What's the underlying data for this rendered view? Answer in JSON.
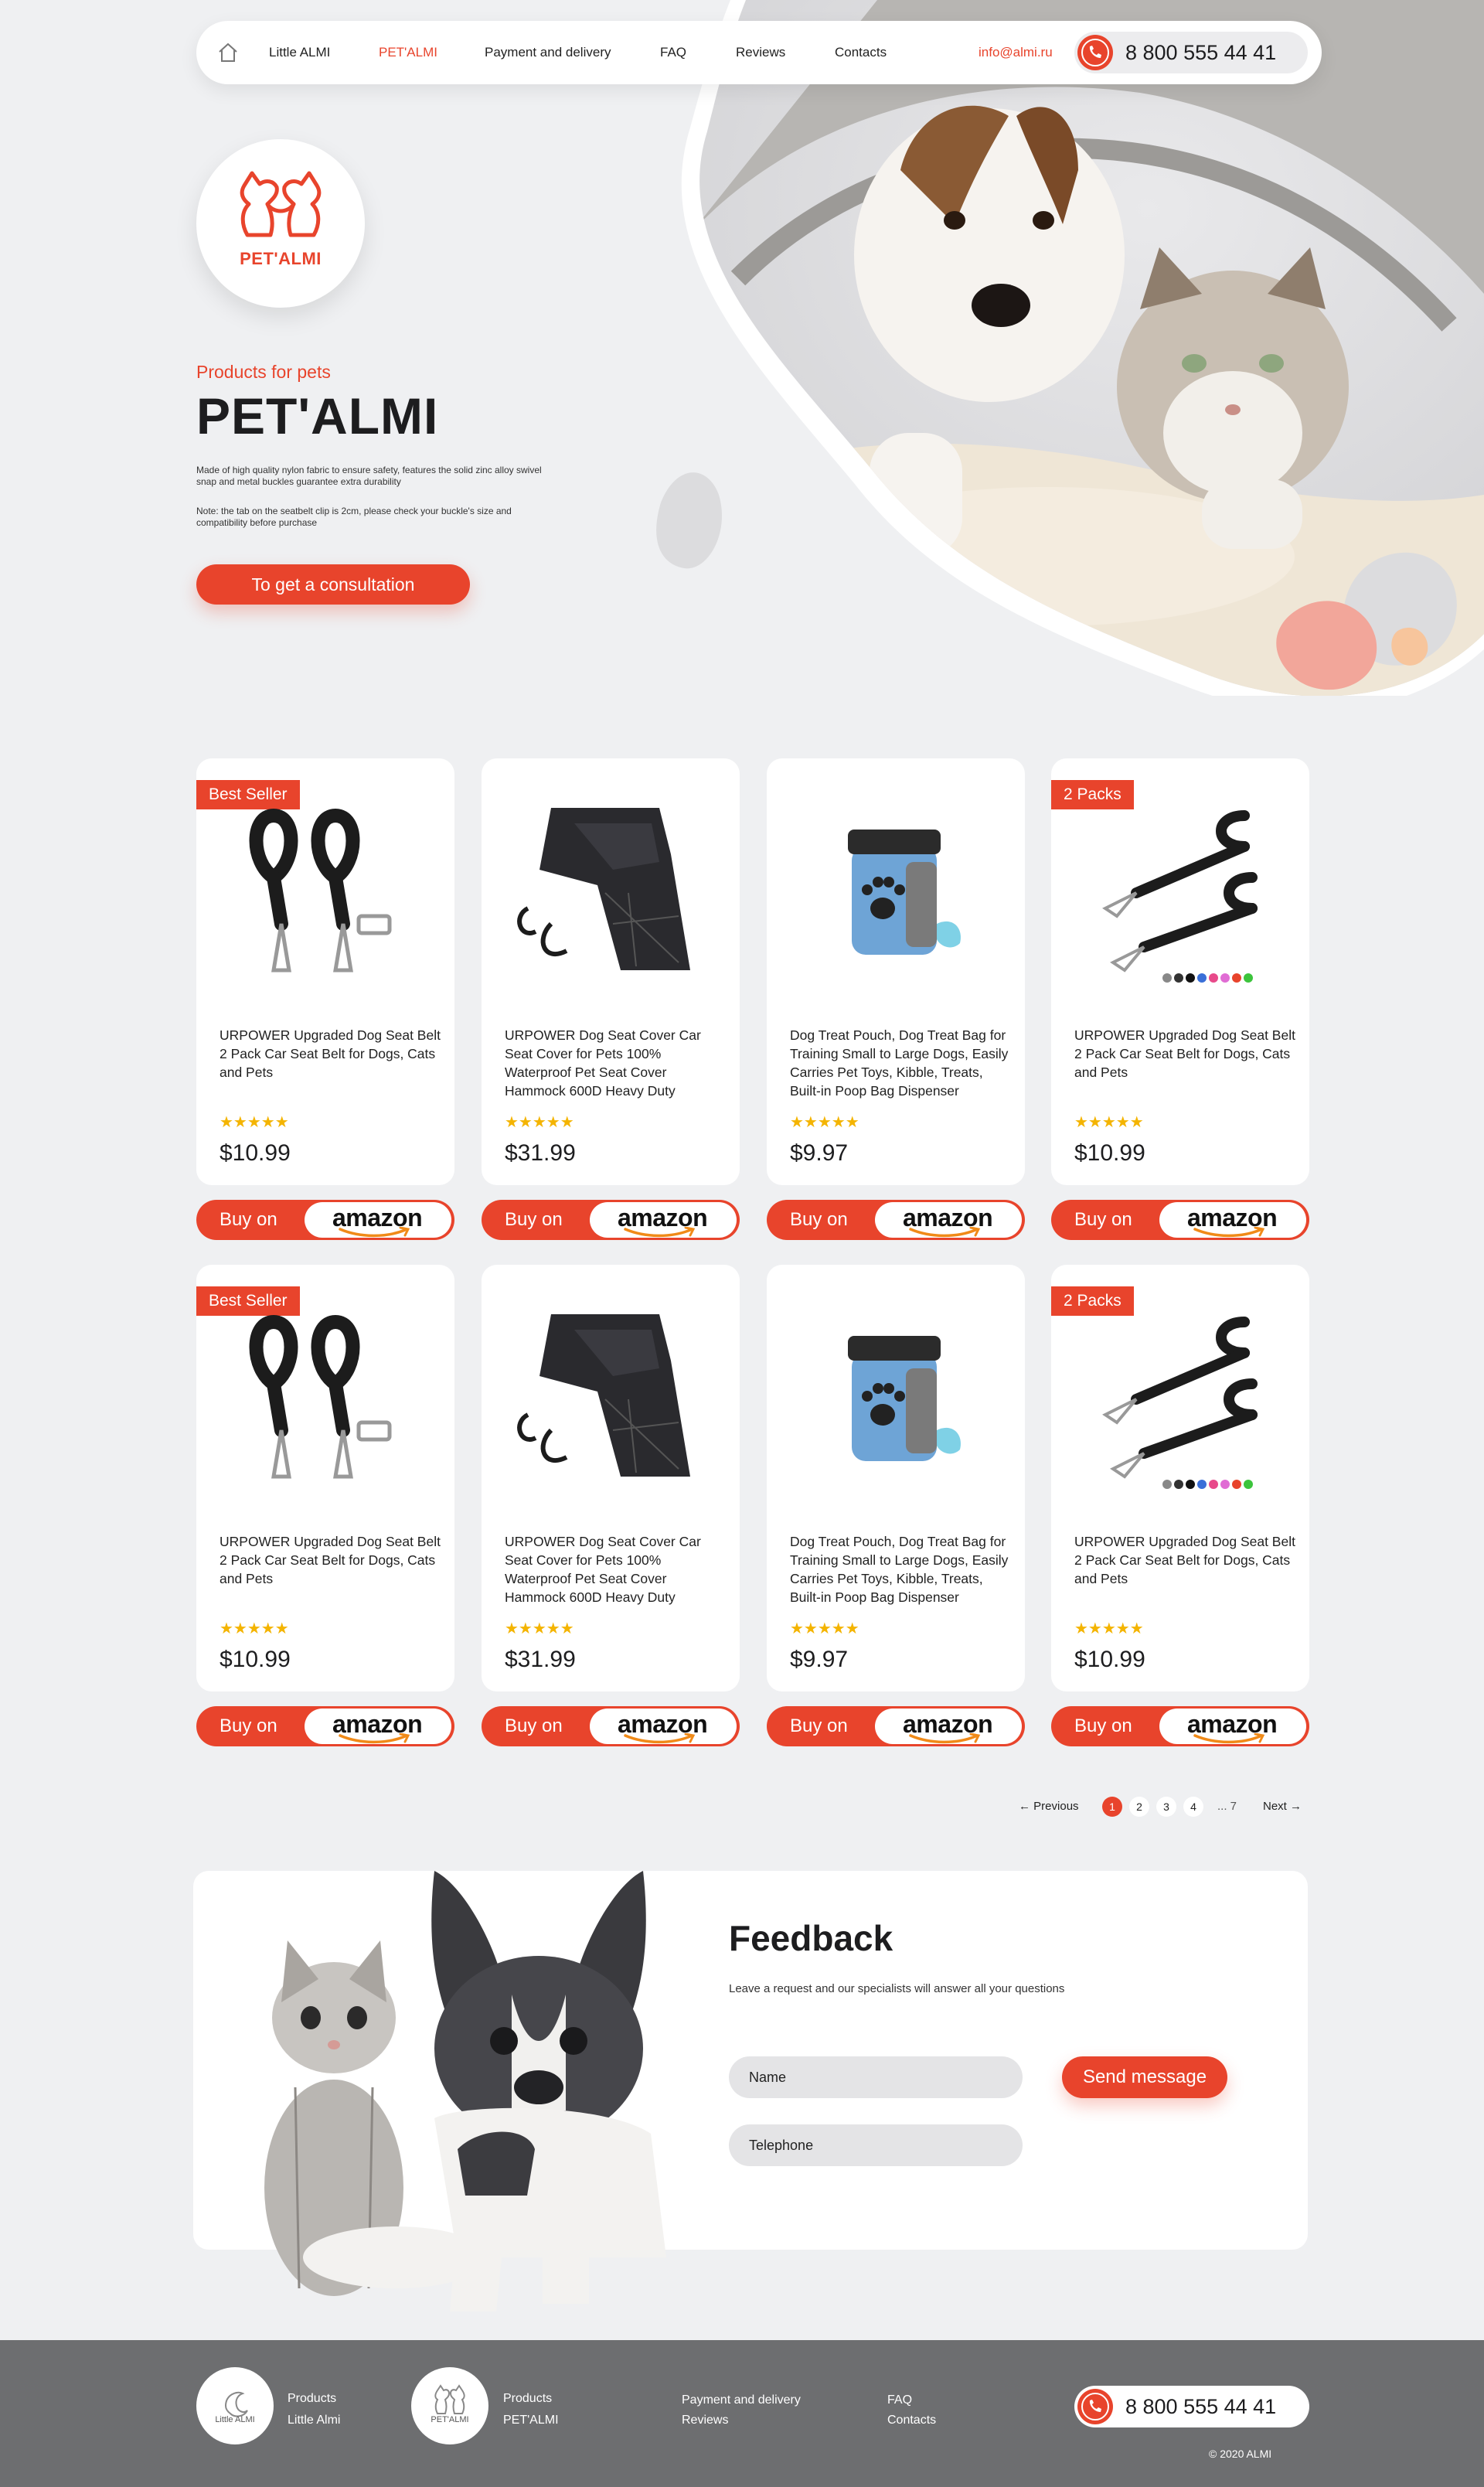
{
  "colors": {
    "accent": "#e8442c",
    "background": "#eff0f2",
    "footer": "#6d6e70",
    "star": "#f4b400"
  },
  "nav": {
    "items": [
      {
        "label": "Little ALMI",
        "active": false
      },
      {
        "label": "PET'ALMI",
        "active": true
      },
      {
        "label": "Payment and delivery",
        "active": false
      },
      {
        "label": "FAQ",
        "active": false
      },
      {
        "label": "Reviews",
        "active": false
      },
      {
        "label": "Contacts",
        "active": false
      }
    ],
    "email": "info@almi.ru",
    "phone": "8 800 555 44 41"
  },
  "hero": {
    "logo_text": "PET'ALMI",
    "kicker": "Products for pets",
    "title": "PET'ALMI",
    "paragraph1": "Made of high quality nylon fabric to ensure safety, features the solid zinc alloy swivel snap and metal buckles guarantee extra durability",
    "paragraph2": "Note: the tab on the seatbelt clip is 2cm, please check your buckle's size and compatibility before purchase",
    "cta": "To get a consultation"
  },
  "products": [
    {
      "badge": "Best Seller",
      "title": "URPOWER Upgraded Dog Seat Belt 2 Pack Car Seat Belt for Dogs, Cats and Pets",
      "rating": 4.5,
      "stars": "★★★★★",
      "price": "$10.99",
      "image": "seat-belt-pair"
    },
    {
      "badge": "",
      "title": "URPOWER Dog Seat Cover Car Seat Cover for Pets 100% Waterproof Pet Seat Cover Hammock 600D Heavy Duty",
      "rating": 4.5,
      "stars": "★★★★★",
      "price": "$31.99",
      "image": "seat-cover"
    },
    {
      "badge": "",
      "title": "Dog Treat Pouch, Dog Treat Bag for Training Small to Large Dogs, Easily Carries Pet Toys, Kibble, Treats, Built-in Poop Bag Dispenser",
      "rating": 4.5,
      "stars": "★★★★★",
      "price": "$9.97",
      "image": "treat-pouch"
    },
    {
      "badge": "2 Packs",
      "title": "URPOWER Upgraded Dog Seat Belt 2 Pack Car Seat Belt for Dogs, Cats and Pets",
      "rating": 4.5,
      "stars": "★★★★★",
      "price": "$10.99",
      "image": "bungee-belt"
    },
    {
      "badge": "Best Seller",
      "title": "URPOWER Upgraded Dog Seat Belt 2 Pack Car Seat Belt for Dogs, Cats and Pets",
      "rating": 4.5,
      "stars": "★★★★★",
      "price": "$10.99",
      "image": "seat-belt-pair"
    },
    {
      "badge": "",
      "title": "URPOWER Dog Seat Cover Car Seat Cover for Pets 100% Waterproof Pet Seat Cover Hammock 600D Heavy Duty",
      "rating": 4.5,
      "stars": "★★★★★",
      "price": "$31.99",
      "image": "seat-cover"
    },
    {
      "badge": "",
      "title": "Dog Treat Pouch, Dog Treat Bag for Training Small to Large Dogs, Easily Carries Pet Toys, Kibble, Treats, Built-in Poop Bag Dispenser",
      "rating": 4.5,
      "stars": "★★★★★",
      "price": "$9.97",
      "image": "treat-pouch"
    },
    {
      "badge": "2 Packs",
      "title": "URPOWER Upgraded Dog Seat Belt 2 Pack Car Seat Belt for Dogs, Cats and Pets",
      "rating": 4.5,
      "stars": "★★★★★",
      "price": "$10.99",
      "image": "bungee-belt"
    }
  ],
  "buy": {
    "label": "Buy on",
    "store": "amazon"
  },
  "pagination": {
    "previous": "Previous",
    "pages": [
      "1",
      "2",
      "3",
      "4"
    ],
    "current": "1",
    "last": "... 7",
    "next": "Next"
  },
  "feedback": {
    "title": "Feedback",
    "subtitle": "Leave a request and our specialists will answer all your questions",
    "name_placeholder": "Name",
    "phone_placeholder": "Telephone",
    "send": "Send message"
  },
  "footer": {
    "logo1_text": "Little ALMI",
    "logo2_text": "PET'ALMI",
    "col1": [
      "Products",
      "Little Almi"
    ],
    "col2": [
      "Products",
      "PET'ALMI"
    ],
    "col3": [
      "Payment and delivery",
      "Reviews"
    ],
    "col4": [
      "FAQ",
      "Contacts"
    ],
    "phone": "8 800 555 44 41",
    "copyright": "© 2020 ALMI"
  }
}
